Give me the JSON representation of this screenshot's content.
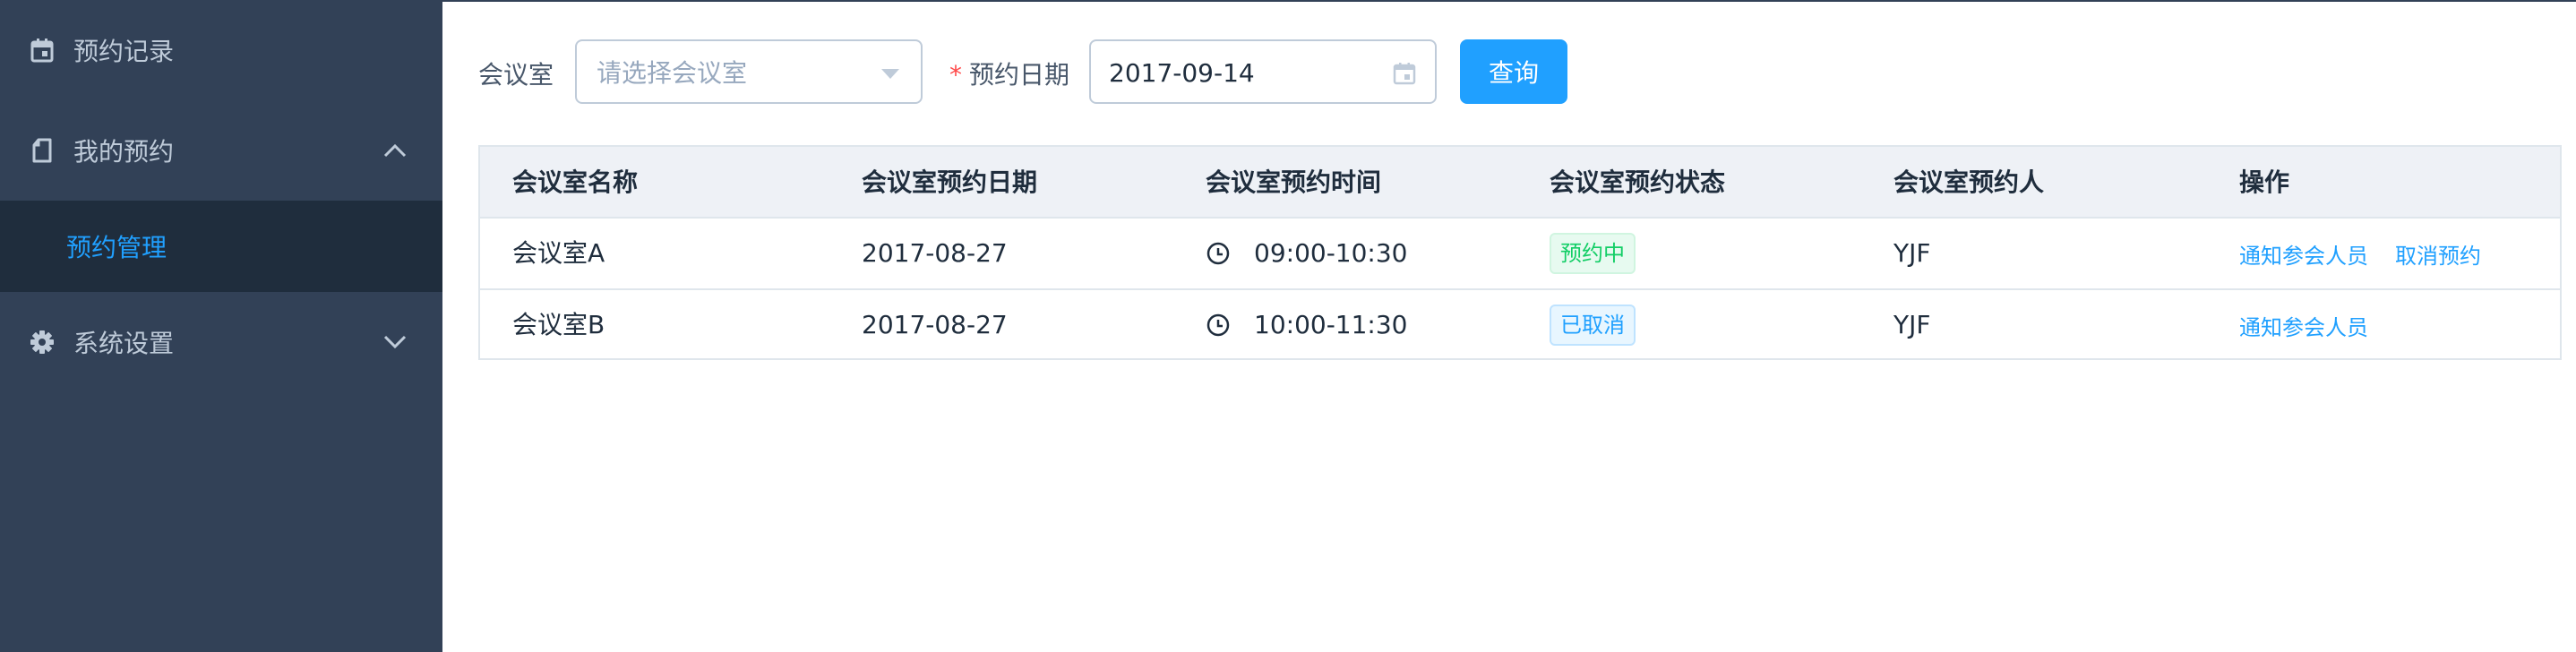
{
  "sidebar": {
    "items": [
      {
        "label": "预约记录",
        "icon": "calendar-icon"
      },
      {
        "label": "我的预约",
        "icon": "document-icon",
        "arrow": "chevron-up-icon",
        "expanded": true,
        "children": [
          {
            "label": "预约管理",
            "active": true
          }
        ]
      },
      {
        "label": "系统设置",
        "icon": "gear-icon",
        "arrow": "chevron-down-icon",
        "expanded": false
      }
    ]
  },
  "filters": {
    "room_label": "会议室",
    "room_placeholder": "请选择会议室",
    "required_mark": "*",
    "date_label": "预约日期",
    "date_value": "2017-09-14",
    "query_button": "查询"
  },
  "table": {
    "headers": [
      "会议室名称",
      "会议室预约日期",
      "会议室预约时间",
      "会议室预约状态",
      "会议室预约人",
      "操作"
    ],
    "rows": [
      {
        "name": "会议室A",
        "date": "2017-08-27",
        "time": "09:00-10:30",
        "status": "预约中",
        "status_color": "#13ce66",
        "person": "YJF",
        "actions": [
          "通知参会人员",
          "取消预约"
        ]
      },
      {
        "name": "会议室B",
        "date": "2017-08-27",
        "time": "10:00-11:30",
        "status": "已取消",
        "status_color": "#20a0ff",
        "person": "YJF",
        "actions": [
          "通知参会人员"
        ]
      }
    ]
  },
  "colors": {
    "sidebar_bg": "#324157",
    "submenu_bg": "#1f2d3d",
    "accent": "#20a0ff",
    "success": "#13ce66"
  }
}
